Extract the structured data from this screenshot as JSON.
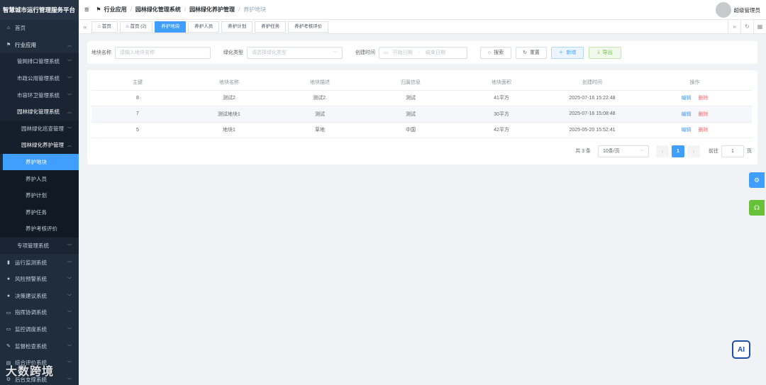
{
  "app": {
    "title": "智慧城市运行管理服务平台"
  },
  "sidebar": {
    "items": [
      {
        "label": "首页",
        "icon": "home-icon",
        "level": 0
      },
      {
        "label": "行业应用",
        "icon": "flag-icon",
        "level": 0,
        "open": true
      },
      {
        "label": "管网排口管理系统",
        "level": 1
      },
      {
        "label": "市政公用管理系统",
        "level": 1
      },
      {
        "label": "市容环卫管理系统",
        "level": 1
      },
      {
        "label": "园林绿化管理系统",
        "level": 1,
        "open": true
      },
      {
        "label": "园林绿化巡查管理",
        "level": 2
      },
      {
        "label": "园林绿化养护管理",
        "level": 2,
        "open": true
      },
      {
        "label": "养护地块",
        "level": 3,
        "active": true
      },
      {
        "label": "养护人员",
        "level": 3
      },
      {
        "label": "养护计划",
        "level": 3
      },
      {
        "label": "养护任务",
        "level": 3
      },
      {
        "label": "养护考核评价",
        "level": 3
      },
      {
        "label": "专项管理系统",
        "level": 1
      },
      {
        "label": "运行监测系统",
        "icon": "chart-icon",
        "level": 0
      },
      {
        "label": "风险预警系统",
        "icon": "bell-icon",
        "level": 0
      },
      {
        "label": "决策建议系统",
        "icon": "user-icon",
        "level": 0
      },
      {
        "label": "指挥协调系统",
        "icon": "truck-icon",
        "level": 0
      },
      {
        "label": "监控调度系统",
        "icon": "monitor-icon",
        "level": 0
      },
      {
        "label": "监督检查系统",
        "icon": "gavel-icon",
        "level": 0
      },
      {
        "label": "综合评价系统",
        "icon": "doc-icon",
        "level": 0
      },
      {
        "label": "后台支撑系统",
        "icon": "gear-icon",
        "level": 0
      }
    ]
  },
  "header": {
    "breadcrumb": [
      "行业应用",
      "园林绿化管理系统",
      "园林绿化养护管理",
      "养护地块"
    ],
    "username": "超级管理员"
  },
  "tags": [
    {
      "label": "首页",
      "icon": "home-icon"
    },
    {
      "label": "首页 (2)",
      "icon": "home-icon"
    },
    {
      "label": "养护地块",
      "active": true
    },
    {
      "label": "养护人员"
    },
    {
      "label": "养护计划"
    },
    {
      "label": "养护任务"
    },
    {
      "label": "养护考核评价"
    }
  ],
  "search": {
    "name_label": "地块名称",
    "name_placeholder": "请输入地块名称",
    "type_label": "绿化类型",
    "type_placeholder": "请选择绿化类型",
    "time_label": "创建时间",
    "start_placeholder": "开始日期",
    "range_sep": "-",
    "end_placeholder": "结束日期",
    "search_btn": "搜索",
    "reset_btn": "重置",
    "add_btn": "新增",
    "export_btn": "导出"
  },
  "table": {
    "headers": [
      "主键",
      "地块名称",
      "地块描述",
      "归属信息",
      "地块面积",
      "创建时间",
      "操作"
    ],
    "rows": [
      [
        "8",
        "测试2",
        "测试2.",
        "测试",
        "41平方",
        "2025-07-16 15:22:48"
      ],
      [
        "7",
        "测试地块1",
        "测试",
        "测试",
        "30平方",
        "2025-07-16 15:08:48"
      ],
      [
        "5",
        "地块1",
        "草地",
        "中国",
        "42平方",
        "2025-05-20 15:52:41"
      ]
    ],
    "edit_label": "编辑",
    "delete_label": "删除"
  },
  "pagination": {
    "total": "共 3 条",
    "page_size": "10条/页",
    "current_page": "1",
    "goto_label": "前往",
    "goto_value": "1",
    "page_unit": "页"
  },
  "ai_label": "AI",
  "watermark": "大数跨境"
}
